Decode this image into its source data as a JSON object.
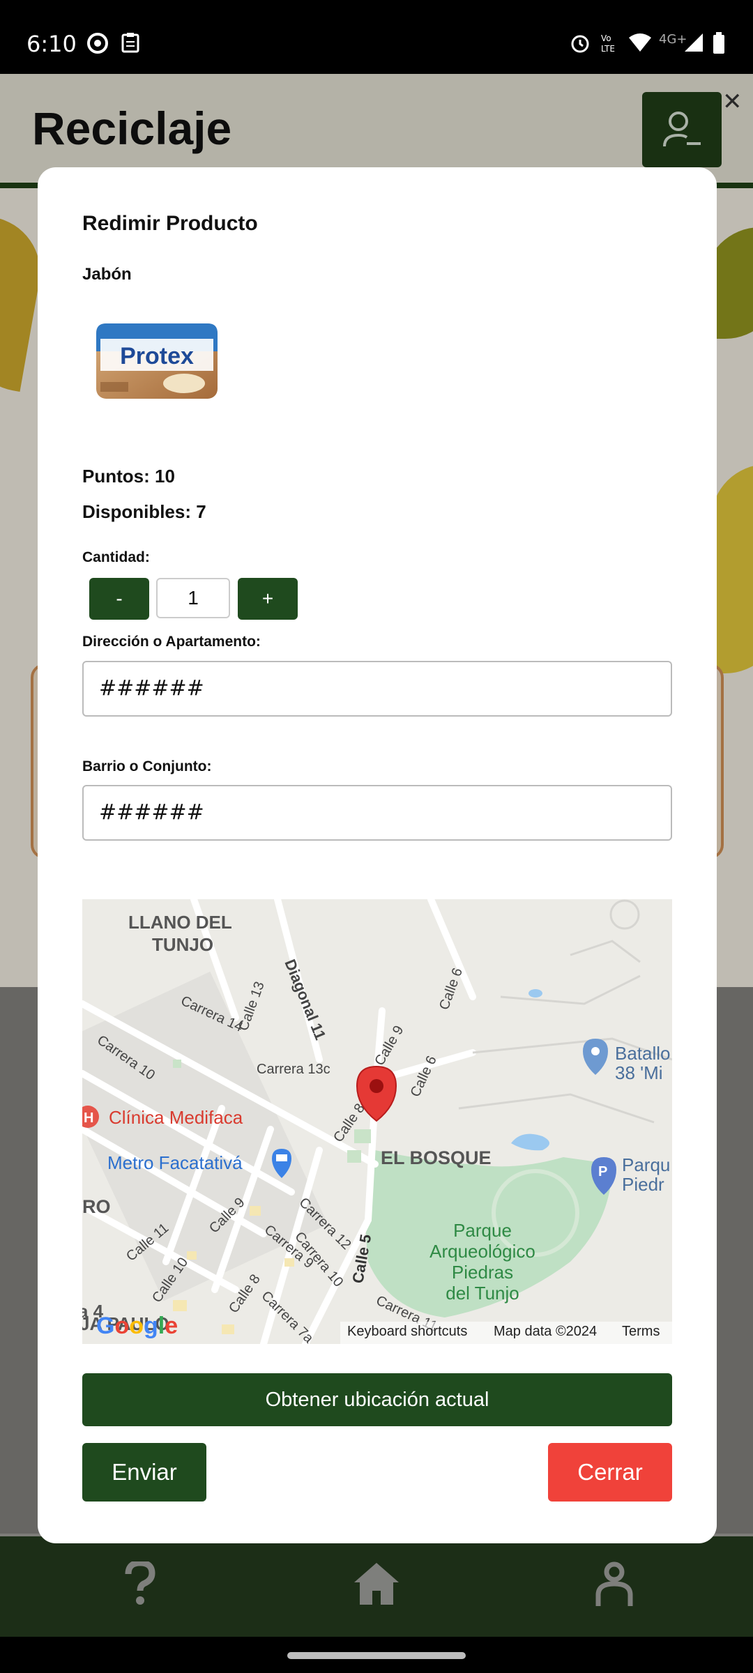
{
  "status_bar": {
    "time": "6:10",
    "network": "4G+"
  },
  "app": {
    "title": "Reciclaje"
  },
  "modal": {
    "title": "Redimir Producto",
    "product_name": "Jabón",
    "product_brand": "Protex",
    "points_label": "Puntos: 10",
    "available_label": "Disponibles: 7",
    "quantity_label": "Cantidad:",
    "quantity_value": "1",
    "minus_label": "-",
    "plus_label": "+",
    "address_label": "Dirección o Apartamento:",
    "address_value": "######",
    "neighborhood_label": "Barrio o Conjunto:",
    "neighborhood_value": "######",
    "location_button": "Obtener ubicación actual",
    "send_button": "Enviar",
    "close_button": "Cerrar"
  },
  "map": {
    "places": {
      "llano_del": "LLANO DEL",
      "tunjo": "TUNJO",
      "diagonal_11": "Diagonal 11",
      "carrera_14": "Carrera 14",
      "calle_13": "Calle 13",
      "calle_6a": "Calle 6",
      "calle_9": "Calle 9",
      "calle_6b": "Calle 6",
      "carrera_10": "Carrera 10",
      "carrera_13c": "Carrera 13c",
      "calle_8": "Calle 8",
      "clinica": "Clínica Medifaca",
      "metro": "Metro Facatativá",
      "el_bosque": "EL BOSQUE",
      "batallon_1": "Batallo",
      "batallon_2": "38 'Mi",
      "parque_1": "Parqu",
      "parque_2": "Piedr",
      "ro": "RO",
      "calle_11": "Calle 11",
      "calle_10": "Calle 10",
      "calle_9b": "Calle 9",
      "carrera_12": "Carrera 12",
      "carrera_9": "Carrera 9",
      "carrera_10b": "Carrera 10",
      "calle_8b": "Calle 8",
      "carrera_7a": "Carrera 7a",
      "calle_5": "Calle 5",
      "carrera_11": "Carrera 11",
      "park_line1": "Parque",
      "park_line2": "Arqueológico",
      "park_line3": "Piedras",
      "park_line4": "del Tunjo",
      "carrera_4": "a 4",
      "paulo": "JA PAULO"
    },
    "attribution": {
      "shortcuts": "Keyboard shortcuts",
      "data": "Map data ©2024",
      "terms": "Terms"
    }
  },
  "colors": {
    "primary": "#1f4a1e",
    "danger": "#f0423a",
    "nav": "#1c2e17"
  }
}
